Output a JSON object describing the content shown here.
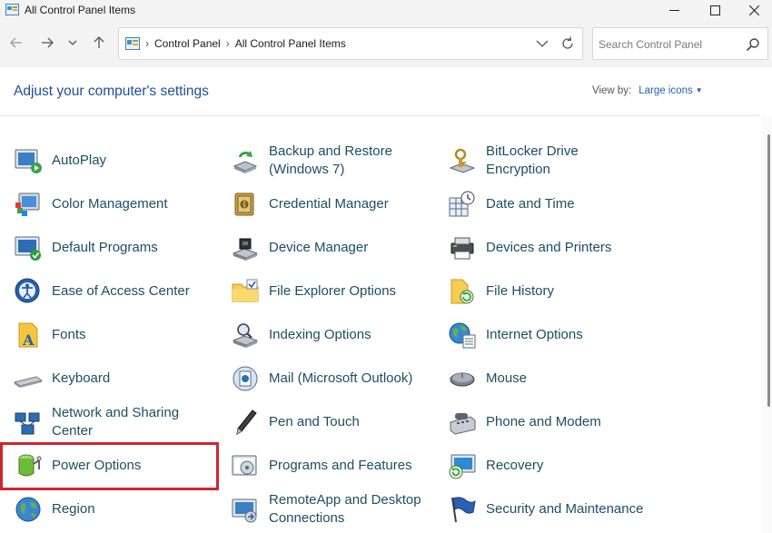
{
  "window": {
    "title": "All Control Panel Items",
    "minimize": "—",
    "maximize": "☐",
    "close": "✕"
  },
  "nav": {
    "back_icon": "arrow-left-icon",
    "forward_icon": "arrow-right-icon",
    "recent_icon": "chevron-down-icon",
    "up_icon": "arrow-up-icon"
  },
  "address": {
    "crumbs": [
      "Control Panel",
      "All Control Panel Items"
    ],
    "separator": "›"
  },
  "search": {
    "placeholder": "Search Control Panel",
    "value": ""
  },
  "header": {
    "title": "Adjust your computer's settings",
    "view_by_label": "View by:",
    "view_by_value": "Large icons"
  },
  "items": [
    [
      "AutoPlay",
      "Backup and Restore (Windows 7)",
      "BitLocker Drive Encryption"
    ],
    [
      "Color Management",
      "Credential Manager",
      "Date and Time"
    ],
    [
      "Default Programs",
      "Device Manager",
      "Devices and Printers"
    ],
    [
      "Ease of Access Center",
      "File Explorer Options",
      "File History"
    ],
    [
      "Fonts",
      "Indexing Options",
      "Internet Options"
    ],
    [
      "Keyboard",
      "Mail (Microsoft Outlook)",
      "Mouse"
    ],
    [
      "Network and Sharing Center",
      "Pen and Touch",
      "Phone and Modem"
    ],
    [
      "Power Options",
      "Programs and Features",
      "Recovery"
    ],
    [
      "Region",
      "RemoteApp and Desktop Connections",
      "Security and Maintenance"
    ]
  ],
  "labels": {
    "autoplay": "AutoPlay",
    "backup_l1": "Backup and Restore",
    "backup_l2": "(Windows 7)",
    "bitlocker_l1": "BitLocker Drive",
    "bitlocker_l2": "Encryption",
    "color": "Color Management",
    "credential": "Credential Manager",
    "datetime": "Date and Time",
    "default": "Default Programs",
    "devicemgr": "Device Manager",
    "devices": "Devices and Printers",
    "ease": "Ease of Access Center",
    "fileexplorer": "File Explorer Options",
    "filehistory": "File History",
    "fonts": "Fonts",
    "indexing": "Indexing Options",
    "internet": "Internet Options",
    "keyboard": "Keyboard",
    "mail": "Mail (Microsoft Outlook)",
    "mouse": "Mouse",
    "network_l1": "Network and Sharing",
    "network_l2": "Center",
    "pen": "Pen and Touch",
    "phone": "Phone and Modem",
    "power": "Power Options",
    "programs": "Programs and Features",
    "recovery": "Recovery",
    "region": "Region",
    "remote_l1": "RemoteApp and Desktop",
    "remote_l2": "Connections",
    "security": "Security and Maintenance"
  },
  "highlight_color": "#d1242f",
  "link_color": "#1d4e63"
}
